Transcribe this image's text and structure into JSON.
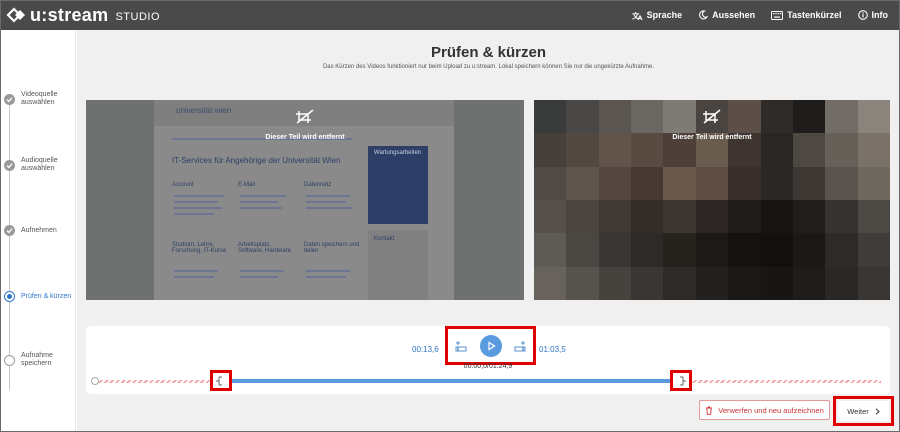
{
  "header": {
    "logo_text": "u:stream",
    "logo_suffix": "STUDIO",
    "menu": [
      {
        "label": "Sprache",
        "icon": "translate-icon"
      },
      {
        "label": "Aussehen",
        "icon": "moon-icon"
      },
      {
        "label": "Tastenkürzel",
        "icon": "keyboard-icon"
      },
      {
        "label": "Info",
        "icon": "info-icon"
      }
    ]
  },
  "steps": [
    {
      "label": "Videoquelle auswählen",
      "status": "done"
    },
    {
      "label": "Audioquelle auswählen",
      "status": "done"
    },
    {
      "label": "Aufnehmen",
      "status": "done"
    },
    {
      "label": "Prüfen & kürzen",
      "status": "active"
    },
    {
      "label": "Aufnahme speichern",
      "status": "todo"
    }
  ],
  "main": {
    "title": "Prüfen & kürzen",
    "subtitle": "Das Kürzen des Videos funktioniert nur beim Upload zu u:stream. Lokal speichern können Sie nur die ungekürzte Aufnahme.",
    "preview_left_label": "Dieser Teil wird entfernt",
    "preview_right_label": "Dieser Teil wird entfernt",
    "webpage": {
      "logo": "universität wien",
      "heading": "IT-Services für Angehörige der Universität Wien",
      "sections": [
        "Account",
        "E-Mail",
        "Datennetz",
        "Studium, Lehre, Forschung, IT-Kurse",
        "Arbeitsplatz, Software, Hardware",
        "Daten speichern und teilen"
      ],
      "side_title": "Wartungsarbeiten",
      "side_title2": "Kontakt"
    }
  },
  "timeline": {
    "start_time": "00:13,6",
    "end_time": "01:03,5",
    "position": "00:00,0/01:24,9",
    "selection_start_fraction": 0.16,
    "selection_end_fraction": 0.745
  },
  "buttons": {
    "discard": "Verwerfen und neu aufzeichnen",
    "next": "Weiter"
  },
  "colors": {
    "header_bg": "#4a4a4a",
    "accent": "#2f75c7",
    "play": "#5a9be0",
    "highlight": "#e10000",
    "danger": "#c83232"
  }
}
